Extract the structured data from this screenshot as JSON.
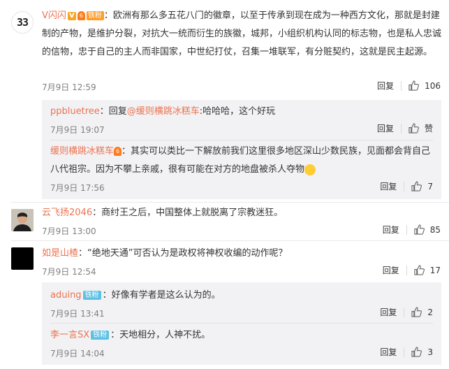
{
  "comments": [
    {
      "user": "V闪闪",
      "fan_badge": "铁粉",
      "level_badge": "6",
      "v_badge": "V",
      "avatar_text": "33",
      "text": "：欧洲有那么多五花八门的徽章，以至于传承到现在成为一种西方文化，那就是封建制的产物，是维护分裂，对抗大一统而衍生的族徽，城邦，小组织机构认同的标志物，也是私人忠诚的信物，忠于自己的主人而非国家，中世纪打仗，召集一堆联军，有分赃契约，这就是民主起源。",
      "time": "7月9日 12:59",
      "reply_label": "回复",
      "likes": "106",
      "replies": [
        {
          "user": "ppbluetree",
          "text_prefix": "：回复",
          "mention": "@缓则横跳冰糕车",
          "text": ":哈哈哈，这个好玩",
          "time": "7月9日 19:07",
          "reply_label": "回复",
          "likes": "赞"
        },
        {
          "user": "缓则横跳冰糕车",
          "level_badge": "6",
          "text": "：其实可以类比一下解放前我们这里很多地区深山少数民族，见面都会背自己八代祖宗。因为不攀上亲戚，很有可能在对方的地盘被杀人夺物",
          "time": "7月9日 17:56",
          "reply_label": "回复",
          "likes": "7"
        }
      ]
    },
    {
      "user": "云飞扬2046",
      "text": "：商纣王之后，中国整体上就脱离了宗教迷狂。",
      "time": "7月9日 13:00",
      "reply_label": "回复",
      "likes": "85"
    },
    {
      "user": "如是山楂",
      "text": "：“绝地天通”可否认为是政权将神权收编的动作呢？",
      "time": "7月9日 12:54",
      "reply_label": "回复",
      "likes": "17",
      "replies": [
        {
          "user": "aduing",
          "fan_badge": "铁粉",
          "text": "：好像有学者是这么认为的。",
          "time": "7月9日 13:41",
          "reply_label": "回复",
          "likes": "2"
        },
        {
          "user": "李一言SX",
          "fan_badge": "铁粉",
          "text": "：天地相分，人神不扰。",
          "time": "7月9日 14:04",
          "reply_label": "回复",
          "likes": "3"
        }
      ]
    }
  ]
}
